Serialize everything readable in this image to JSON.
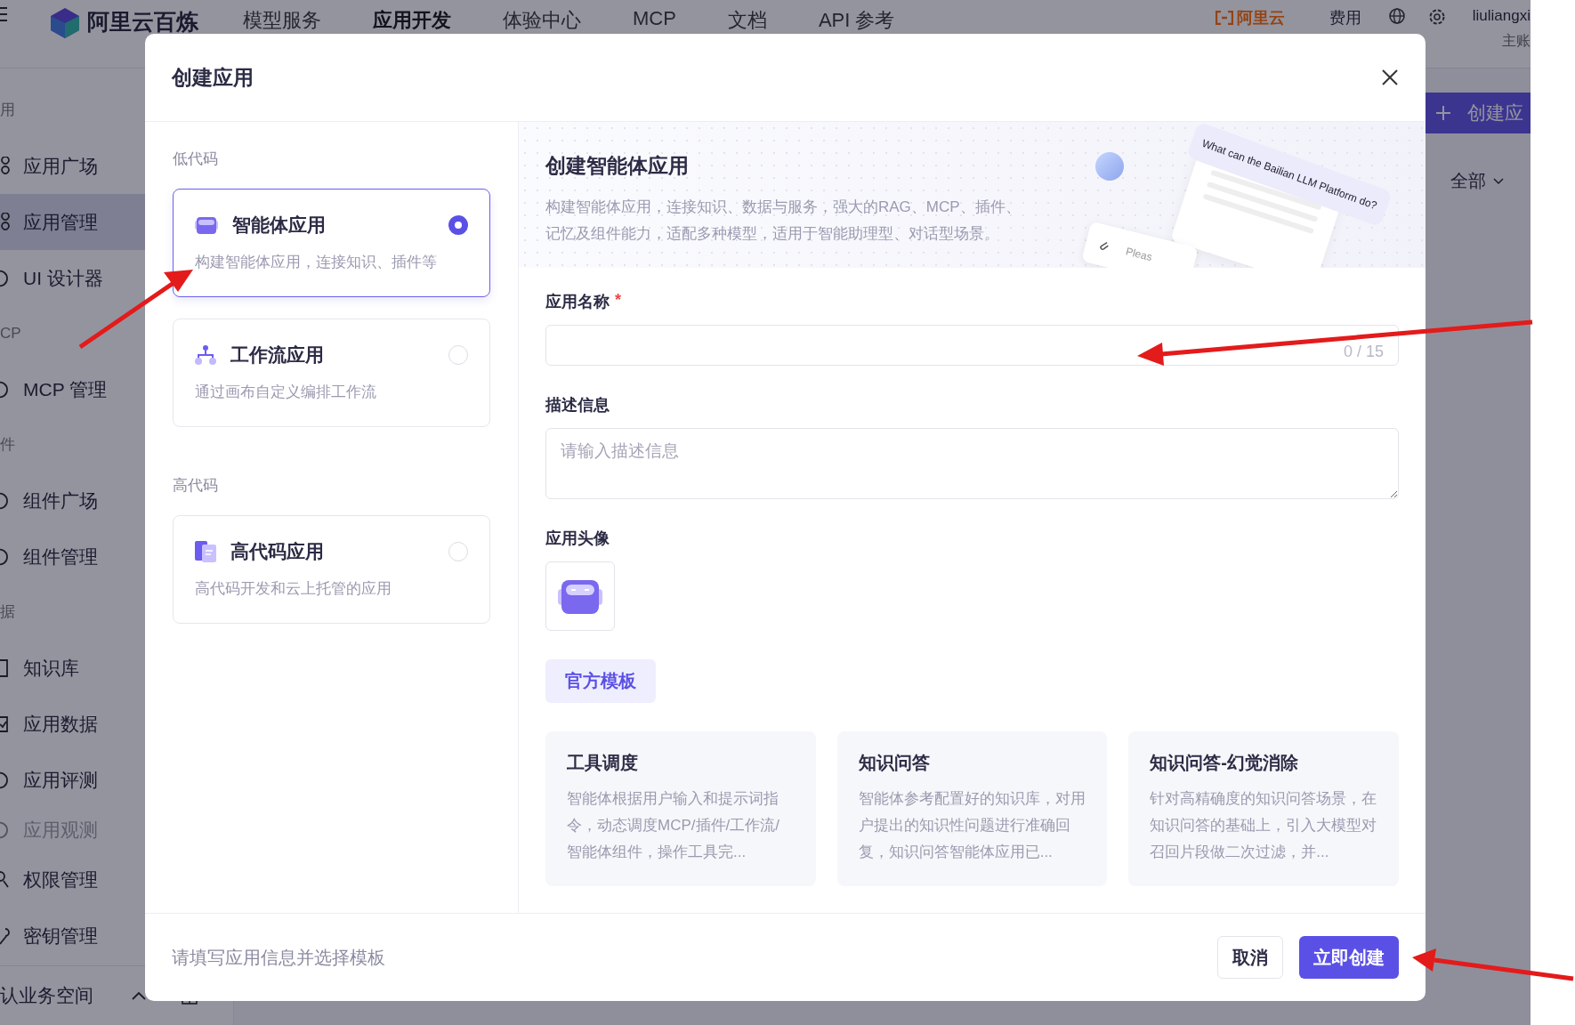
{
  "top_nav": {
    "brand": "阿里云百炼",
    "items": [
      {
        "label": "模型服务",
        "selected": false
      },
      {
        "label": "应用开发",
        "selected": true
      },
      {
        "label": "体验中心",
        "selected": false
      },
      {
        "label": "MCP",
        "selected": false
      },
      {
        "label": "文档",
        "selected": false
      },
      {
        "label": "API 参考",
        "selected": false
      }
    ],
    "partner_logo": "阿里云",
    "fee": "费用",
    "user": {
      "name": "liuliangxi",
      "role": "主账"
    }
  },
  "sidebar": {
    "groups": [
      {
        "title": "用",
        "items": [
          {
            "label": "应用广场",
            "kind": "plaza",
            "selected": false,
            "disabled": false
          },
          {
            "label": "应用管理",
            "kind": "plaza",
            "selected": true,
            "disabled": false
          },
          {
            "label": "UI 设计器",
            "kind": "palette",
            "selected": false,
            "disabled": false
          }
        ]
      },
      {
        "title": "CP",
        "items": [
          {
            "label": "MCP 管理",
            "kind": "mcp",
            "selected": false,
            "disabled": false
          }
        ]
      },
      {
        "title": "件",
        "items": [
          {
            "label": "组件广场",
            "kind": "puzzle",
            "selected": false,
            "disabled": false
          },
          {
            "label": "组件管理",
            "kind": "puzzle",
            "selected": false,
            "disabled": false
          }
        ]
      },
      {
        "title": "据",
        "items": [
          {
            "label": "知识库",
            "kind": "book",
            "selected": false,
            "disabled": false
          },
          {
            "label": "应用数据",
            "kind": "check",
            "selected": false,
            "disabled": false
          },
          {
            "label": "应用评测",
            "kind": "gauge",
            "selected": false,
            "disabled": false
          },
          {
            "label": "应用观测",
            "kind": "pie",
            "selected": false,
            "disabled": true
          },
          {
            "label": "权限管理",
            "kind": "user",
            "selected": false,
            "disabled": false
          },
          {
            "label": "密钥管理",
            "kind": "key",
            "selected": false,
            "disabled": false
          }
        ]
      }
    ],
    "workspace": "认业务空间"
  },
  "page": {
    "create_button": "创建应",
    "filter": "全部"
  },
  "dialog": {
    "title": "创建应用",
    "categories": [
      {
        "title": "低代码",
        "options": [
          {
            "kind": "agent",
            "title": "智能体应用",
            "description": "构建智能体应用，连接知识、插件等",
            "selected": true
          },
          {
            "kind": "workflow",
            "title": "工作流应用",
            "description": "通过画布自定义编排工作流",
            "selected": false
          }
        ]
      },
      {
        "title": "高代码",
        "options": [
          {
            "kind": "code",
            "title": "高代码应用",
            "description": "高代码开发和云上托管的应用",
            "selected": false
          }
        ]
      }
    ],
    "banner": {
      "title": "创建智能体应用",
      "description": "构建智能体应用，连接知识、数据与服务，强大的RAG、MCP、插件、记忆及组件能力，适配多种模型，适用于智能助理型、对话型场景。",
      "bubble": "What can the Bailian LLM Platform do?",
      "input_hint": "Pleas"
    },
    "form": {
      "name": {
        "label": "应用名称",
        "required_mark": "*",
        "counter": "0 / 15"
      },
      "description": {
        "label": "描述信息",
        "placeholder": "请输入描述信息"
      },
      "avatar": {
        "label": "应用头像"
      }
    },
    "template_tabs": [
      {
        "label": "官方模板",
        "selected": true
      }
    ],
    "templates": [
      {
        "title": "工具调度",
        "description": "智能体根据用户输入和提示词指令，动态调度MCP/插件/工作流/智能体组件，操作工具完..."
      },
      {
        "title": "知识问答",
        "description": "智能体参考配置好的知识库，对用户提出的知识性问题进行准确回复，知识问答智能体应用已..."
      },
      {
        "title": "知识问答-幻觉消除",
        "description": "针对高精确度的知识问答场景，在知识问答的基础上，引入大模型对召回片段做二次过滤，并..."
      }
    ],
    "footer": {
      "hint": "请填写应用信息并选择模板",
      "cancel": "取消",
      "submit": "立即创建"
    }
  }
}
